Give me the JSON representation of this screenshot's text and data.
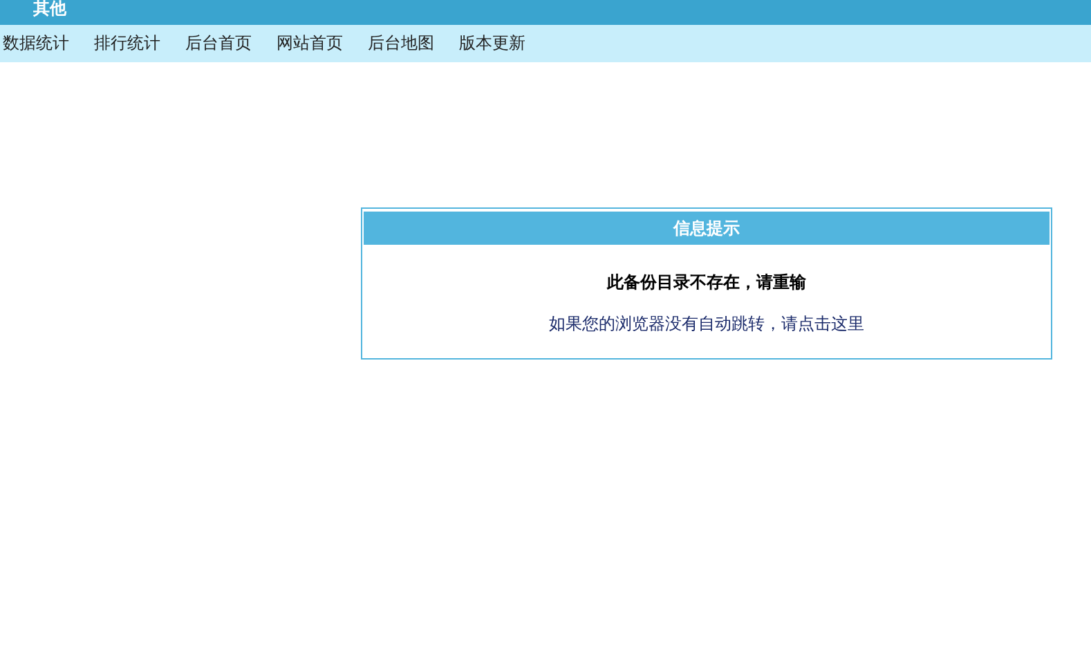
{
  "header": {
    "title": "其他"
  },
  "nav": {
    "items": [
      "数据统计",
      "排行统计",
      "后台首页",
      "网站首页",
      "后台地图",
      "版本更新"
    ]
  },
  "message_box": {
    "title": "信息提示",
    "message": "此备份目录不存在，请重输",
    "redirect_link": "如果您的浏览器没有自动跳转，请点击这里"
  }
}
